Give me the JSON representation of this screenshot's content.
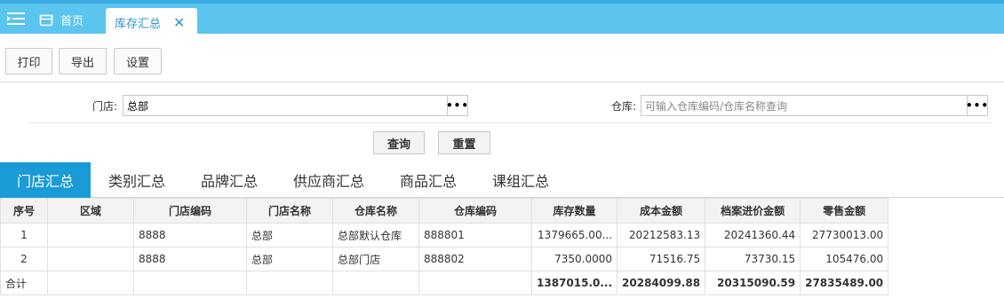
{
  "header": {
    "home_tab": "首页",
    "active_tab": "库存汇总",
    "close_glyph": "✕",
    "accent": "#5bc4ef"
  },
  "toolbar": {
    "print": "打印",
    "export": "导出",
    "settings": "设置"
  },
  "filters": {
    "store_label": "门店:",
    "store_value": "总部",
    "warehouse_label": "仓库:",
    "warehouse_placeholder": "可输入仓库编码/仓库名称查询",
    "more_glyph": "•••",
    "query": "查询",
    "reset": "重置"
  },
  "summary_tabs": [
    {
      "label": "门店汇总",
      "active": true
    },
    {
      "label": "类别汇总",
      "active": false
    },
    {
      "label": "品牌汇总",
      "active": false
    },
    {
      "label": "供应商汇总",
      "active": false
    },
    {
      "label": "商品汇总",
      "active": false
    },
    {
      "label": "课组汇总",
      "active": false
    }
  ],
  "table": {
    "columns": [
      "序号",
      "区域",
      "门店编码",
      "门店名称",
      "仓库名称",
      "仓库编码",
      "库存数量",
      "成本金额",
      "档案进价金额",
      "零售金额"
    ],
    "rows": [
      [
        "1",
        "",
        "8888",
        "总部",
        "总部默认仓库",
        "888801",
        "1379665.00...",
        "20212583.13",
        "20241360.44",
        "27730013.00"
      ],
      [
        "2",
        "",
        "8888",
        "总部",
        "总部门店",
        "888802",
        "7350.0000",
        "71516.75",
        "73730.15",
        "105476.00"
      ]
    ],
    "total": [
      "合计",
      "",
      "",
      "",
      "",
      "",
      "1387015.0...",
      "20284099.88",
      "20315090.59",
      "27835489.00"
    ]
  }
}
